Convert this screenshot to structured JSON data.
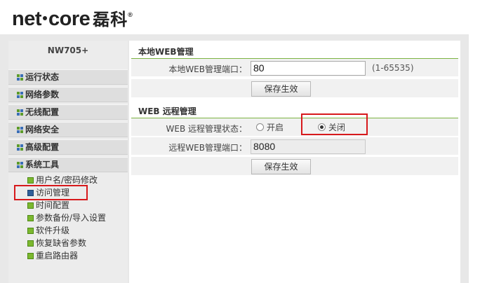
{
  "header": {
    "brand": "net",
    "brand2": "core",
    "brand_cn": "磊科",
    "reg": "®"
  },
  "sidebar": {
    "model": "NW705+",
    "menu": [
      {
        "label": "运行状态"
      },
      {
        "label": "网络参数"
      },
      {
        "label": "无线配置"
      },
      {
        "label": "网络安全"
      },
      {
        "label": "高级配置"
      },
      {
        "label": "系统工具"
      }
    ],
    "submenu": [
      {
        "label": "用户名/密码修改"
      },
      {
        "label": "访问管理"
      },
      {
        "label": "时间配置"
      },
      {
        "label": "参数备份/导入设置"
      },
      {
        "label": "软件升级"
      },
      {
        "label": "恢复缺省参数"
      },
      {
        "label": "重启路由器"
      }
    ]
  },
  "local": {
    "title": "本地WEB管理",
    "port_label": "本地WEB管理端口：",
    "port_value": "80",
    "port_hint": "(1-65535)",
    "save": "保存生效"
  },
  "remote": {
    "title": "WEB 远程管理",
    "status_label": "WEB 远程管理状态：",
    "on": "开启",
    "off": "关闭",
    "selected": "关闭",
    "port_label": "远程WEB管理端口：",
    "port_value": "8080",
    "save": "保存生效"
  }
}
